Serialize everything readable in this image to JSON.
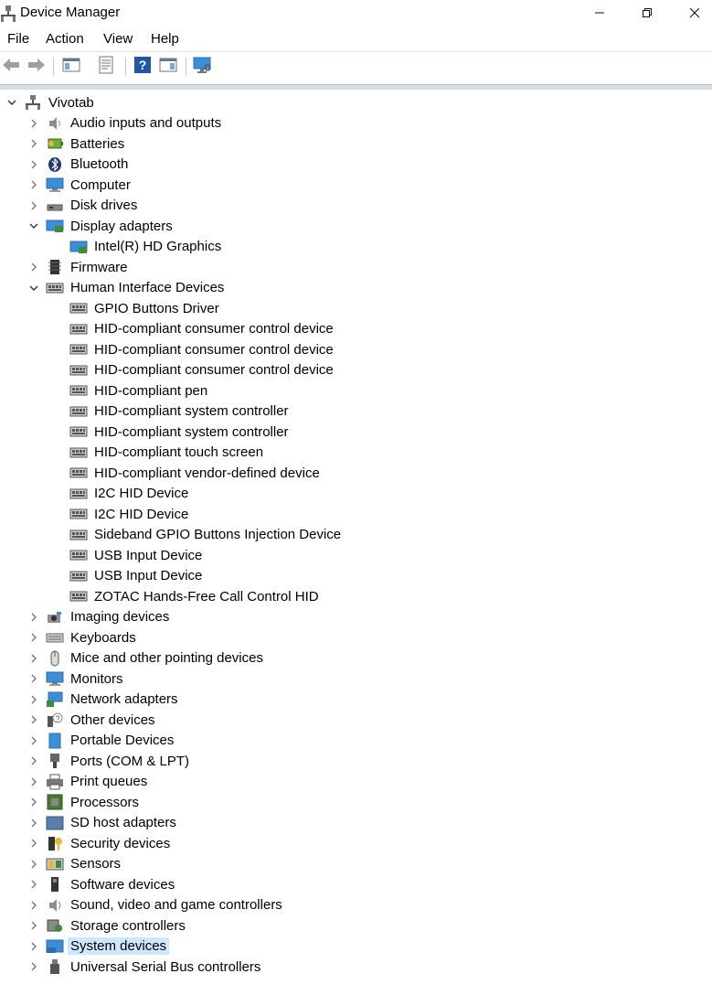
{
  "window": {
    "title": "Device Manager"
  },
  "menu": [
    "File",
    "Action",
    "View",
    "Help"
  ],
  "toolbar": [
    "back-icon",
    "forward-icon",
    "console-tree-icon",
    "properties-icon",
    "help-icon",
    "show-hide-icon",
    "monitor-scan-icon"
  ],
  "tree": {
    "root": "Vivotab",
    "categories": [
      {
        "label": "Audio inputs and outputs",
        "icon": "speaker-icon",
        "expanded": false
      },
      {
        "label": "Batteries",
        "icon": "battery-icon",
        "expanded": false
      },
      {
        "label": "Bluetooth",
        "icon": "bluetooth-icon",
        "expanded": false
      },
      {
        "label": "Computer",
        "icon": "computer-icon",
        "expanded": false
      },
      {
        "label": "Disk drives",
        "icon": "disk-drive-icon",
        "expanded": false
      },
      {
        "label": "Display adapters",
        "icon": "display-adapter-icon",
        "expanded": true,
        "children": [
          "Intel(R) HD Graphics"
        ]
      },
      {
        "label": "Firmware",
        "icon": "firmware-icon",
        "expanded": false
      },
      {
        "label": "Human Interface Devices",
        "icon": "hid-icon",
        "expanded": true,
        "children": [
          "GPIO Buttons Driver",
          "HID-compliant consumer control device",
          "HID-compliant consumer control device",
          "HID-compliant consumer control device",
          "HID-compliant pen",
          "HID-compliant system controller",
          "HID-compliant system controller",
          "HID-compliant touch screen",
          "HID-compliant vendor-defined device",
          "I2C HID Device",
          "I2C HID Device",
          "Sideband GPIO Buttons Injection Device",
          "USB Input Device",
          "USB Input Device",
          "ZOTAC Hands-Free Call Control HID"
        ]
      },
      {
        "label": "Imaging devices",
        "icon": "camera-icon",
        "expanded": false
      },
      {
        "label": "Keyboards",
        "icon": "keyboard-icon",
        "expanded": false
      },
      {
        "label": "Mice and other pointing devices",
        "icon": "mouse-icon",
        "expanded": false
      },
      {
        "label": "Monitors",
        "icon": "monitor-icon",
        "expanded": false
      },
      {
        "label": "Network adapters",
        "icon": "network-adapter-icon",
        "expanded": false
      },
      {
        "label": "Other devices",
        "icon": "unknown-device-icon",
        "expanded": false
      },
      {
        "label": "Portable Devices",
        "icon": "portable-device-icon",
        "expanded": false
      },
      {
        "label": "Ports (COM & LPT)",
        "icon": "port-icon",
        "expanded": false
      },
      {
        "label": "Print queues",
        "icon": "printer-icon",
        "expanded": false
      },
      {
        "label": "Processors",
        "icon": "processor-icon",
        "expanded": false
      },
      {
        "label": "SD host adapters",
        "icon": "sd-card-icon",
        "expanded": false
      },
      {
        "label": "Security devices",
        "icon": "security-key-icon",
        "expanded": false
      },
      {
        "label": "Sensors",
        "icon": "sensor-icon",
        "expanded": false
      },
      {
        "label": "Software devices",
        "icon": "software-device-icon",
        "expanded": false
      },
      {
        "label": "Sound, video and game controllers",
        "icon": "sound-icon",
        "expanded": false
      },
      {
        "label": "Storage controllers",
        "icon": "storage-controller-icon",
        "expanded": false
      },
      {
        "label": "System devices",
        "icon": "system-devices-icon",
        "expanded": false,
        "selected": true
      },
      {
        "label": "Universal Serial Bus controllers",
        "icon": "usb-icon",
        "expanded": false
      }
    ]
  },
  "colors": {
    "selection": "#cce8ff",
    "accent": "#1e73be"
  }
}
